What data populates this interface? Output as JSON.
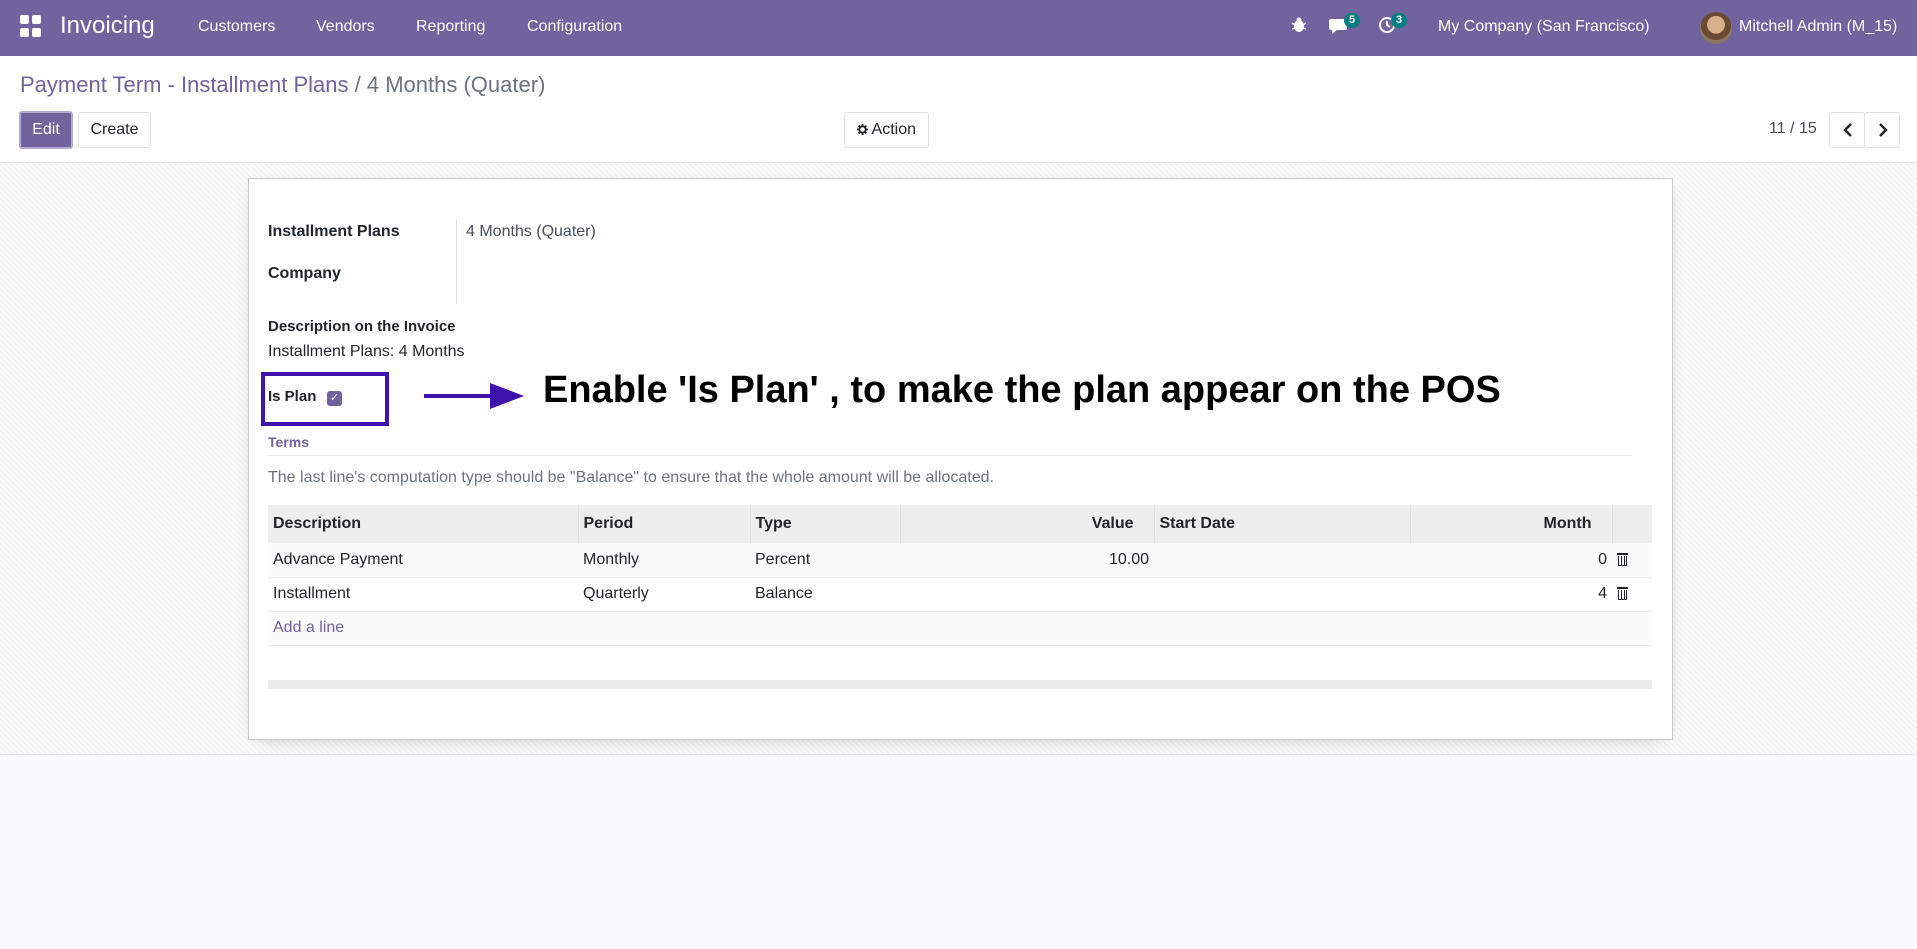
{
  "topbar": {
    "app_name": "Invoicing",
    "menu": [
      "Customers",
      "Vendors",
      "Reporting",
      "Configuration"
    ],
    "messages_count": "5",
    "activities_count": "3",
    "company": "My Company (San Francisco)",
    "user": "Mitchell Admin (M_15)"
  },
  "breadcrumb": {
    "parent": "Payment Term - Installment Plans",
    "separator": "/",
    "current": "4 Months (Quater)"
  },
  "toolbar": {
    "edit_label": "Edit",
    "create_label": "Create",
    "action_label": "Action",
    "pager": "11 / 15"
  },
  "form": {
    "installment_plans_label": "Installment Plans",
    "installment_plans_value": "4 Months (Quater)",
    "company_label": "Company",
    "description_label": "Description on the Invoice",
    "description_value": "Installment Plans: 4 Months",
    "is_plan_label": "Is Plan",
    "is_plan_checked": true
  },
  "annotation": {
    "text": "Enable 'Is Plan' , to make the plan appear on the POS",
    "color": "#3f12ad"
  },
  "terms": {
    "tab_label": "Terms",
    "hint": "The last line's computation type should be \"Balance\" to ensure that the whole amount will be allocated.",
    "columns": {
      "description": "Description",
      "period": "Period",
      "type": "Type",
      "value": "Value",
      "start_date": "Start Date",
      "month": "Month"
    },
    "rows": [
      {
        "description": "Advance Payment",
        "period": "Monthly",
        "type": "Percent",
        "value": "10.00",
        "start_date": "",
        "month": "0"
      },
      {
        "description": "Installment",
        "period": "Quarterly",
        "type": "Balance",
        "value": "",
        "start_date": "",
        "month": "4"
      }
    ],
    "add_line": "Add a line"
  },
  "colors": {
    "brand": "#71639e",
    "badge": "#017e84"
  }
}
